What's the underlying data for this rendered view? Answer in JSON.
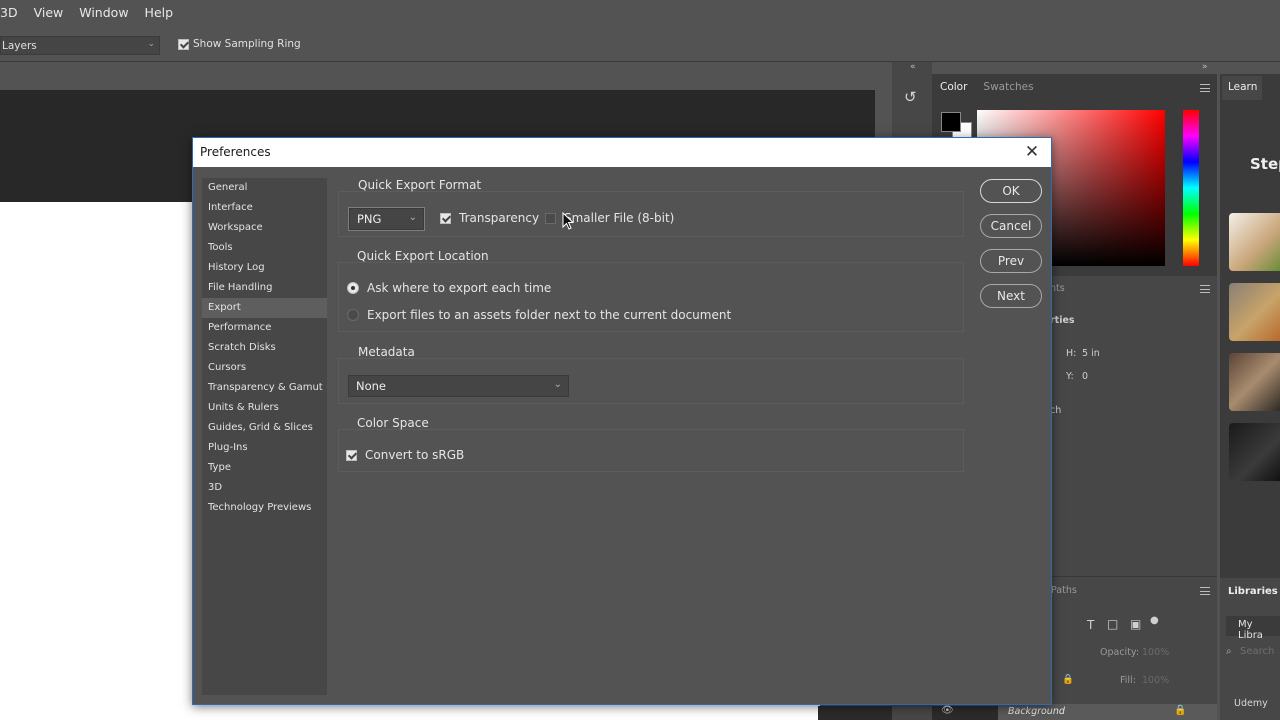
{
  "menubar": {
    "items": [
      "3D",
      "View",
      "Window",
      "Help"
    ]
  },
  "options_bar": {
    "sample_select": "Layers",
    "show_sampling_ring": "Show Sampling Ring"
  },
  "right_panels": {
    "color_tab": "Color",
    "swatches_tab": "Swatches",
    "learn_tab": "Learn",
    "learn_heading": "Step",
    "mid_tab_fragment": "nts",
    "properties_fragment": "rties",
    "h_label": "H:",
    "h_value": "5 in",
    "y_label": "Y:",
    "y_value": "0",
    "ch_fragment": "ch",
    "paths_tab": "Paths",
    "opacity_label": "Opacity:",
    "opacity_value": "100%",
    "fill_label": "Fill:",
    "fill_value": "100%",
    "background_layer": "Background",
    "libraries_tab": "Libraries",
    "my_library": "My Libra",
    "search_placeholder": "Search",
    "udemy": "Udemy"
  },
  "dialog": {
    "title": "Preferences",
    "sidebar": [
      "General",
      "Interface",
      "Workspace",
      "Tools",
      "History Log",
      "File Handling",
      "Export",
      "Performance",
      "Scratch Disks",
      "Cursors",
      "Transparency & Gamut",
      "Units & Rulers",
      "Guides, Grid & Slices",
      "Plug-Ins",
      "Type",
      "3D",
      "Technology Previews"
    ],
    "active_item": "Export",
    "format": {
      "title": "Quick Export Format",
      "format_value": "PNG",
      "transparency_label": "Transparency",
      "transparency_checked": true,
      "smaller_file_label": "Smaller File (8-bit)",
      "smaller_file_checked": false
    },
    "location": {
      "title": "Quick Export Location",
      "option_ask": "Ask where to export each time",
      "option_assets": "Export files to an assets folder next to the current document",
      "selected": "ask"
    },
    "metadata": {
      "title": "Metadata",
      "value": "None"
    },
    "color_space": {
      "title": "Color Space",
      "convert_label": "Convert to sRGB",
      "convert_checked": true
    },
    "buttons": {
      "ok": "OK",
      "cancel": "Cancel",
      "prev": "Prev",
      "next": "Next"
    }
  }
}
